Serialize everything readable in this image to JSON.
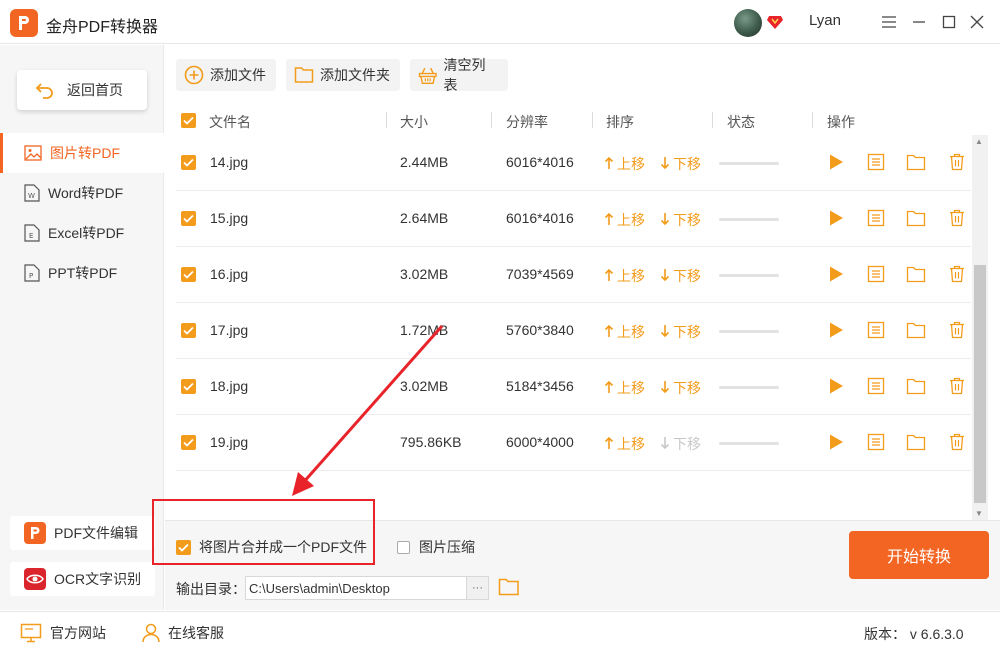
{
  "window": {
    "title": "金舟PDF转换器",
    "username": "Lyan"
  },
  "sidebar": {
    "home_label": "返回首页",
    "items": [
      {
        "label": "图片转PDF",
        "active": true
      },
      {
        "label": "Word转PDF",
        "active": false
      },
      {
        "label": "Excel转PDF",
        "active": false
      },
      {
        "label": "PPT转PDF",
        "active": false
      }
    ],
    "tools": [
      {
        "label": "PDF文件编辑"
      },
      {
        "label": "OCR文字识别"
      }
    ]
  },
  "toolbar": {
    "add_file": "添加文件",
    "add_folder": "添加文件夹",
    "clear_list": "清空列表"
  },
  "table": {
    "headers": {
      "name": "文件名",
      "size": "大小",
      "resolution": "分辨率",
      "sort": "排序",
      "status": "状态",
      "actions": "操作"
    },
    "move_up": "上移",
    "move_down": "下移",
    "rows": [
      {
        "name": "14.jpg",
        "size": "2.44MB",
        "resolution": "6016*4016",
        "progress": 0,
        "down_enabled": true
      },
      {
        "name": "15.jpg",
        "size": "2.64MB",
        "resolution": "6016*4016",
        "progress": 0,
        "down_enabled": true
      },
      {
        "name": "16.jpg",
        "size": "3.02MB",
        "resolution": "7039*4569",
        "progress": 0,
        "down_enabled": true
      },
      {
        "name": "17.jpg",
        "size": "1.72MB",
        "resolution": "5760*3840",
        "progress": 0,
        "down_enabled": true
      },
      {
        "name": "18.jpg",
        "size": "3.02MB",
        "resolution": "5184*3456",
        "progress": 0,
        "down_enabled": true
      },
      {
        "name": "19.jpg",
        "size": "795.86KB",
        "resolution": "6000*4000",
        "progress": 0,
        "down_enabled": false
      }
    ]
  },
  "options": {
    "merge_label": "将图片合并成一个PDF文件",
    "merge_checked": true,
    "compress_label": "图片压缩",
    "compress_checked": false
  },
  "output": {
    "label": "输出目录：",
    "path": "C:\\Users\\admin\\Desktop",
    "browse": "···"
  },
  "start_label": "开始转换",
  "footer": {
    "website": "官方网站",
    "support": "在线客服",
    "version": "版本： v 6.6.3.0"
  },
  "colors": {
    "accent": "#f26522",
    "check": "#f39b1a",
    "highlight": "#e8232a"
  }
}
